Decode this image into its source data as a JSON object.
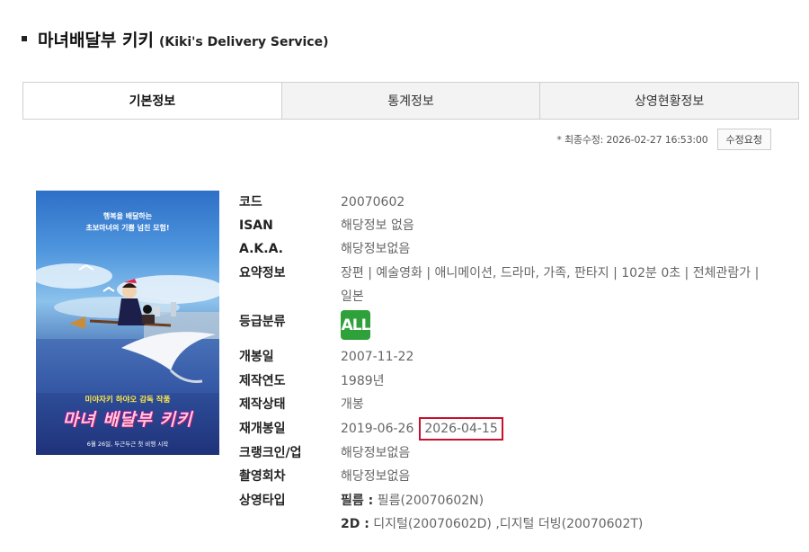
{
  "movie": {
    "title_ko": "마녀배달부 키키",
    "title_en": "(Kiki's Delivery Service)"
  },
  "tabs": [
    {
      "label": "기본정보",
      "active": true
    },
    {
      "label": "통계정보",
      "active": false
    },
    {
      "label": "상영현황정보",
      "active": false
    }
  ],
  "modification": {
    "text": "* 최종수정: 2026-02-27 16:53:00",
    "button_label": "수정요청"
  },
  "poster": {
    "tagline_line1": "행복을 배달하는",
    "tagline_line2": "초보마녀의 기쁨 넘친 모험!",
    "director": "미야자키 하야오 감독 작품",
    "title": "마녀 배달부 키키",
    "release": "6월 26일, 두근두근 첫 비행 시작"
  },
  "details": {
    "code": {
      "label": "코드",
      "value": "20070602"
    },
    "isan": {
      "label": "ISAN",
      "value": "해당정보 없음"
    },
    "aka": {
      "label": "A.K.A.",
      "value": "해당정보없음"
    },
    "summary": {
      "label": "요약정보",
      "value_line1": "장편 | 예술영화 | 애니메이션, 드라마, 가족, 판타지 | 102분 0초 | 전체관람가 |",
      "value_line2": "일본"
    },
    "rating": {
      "label": "등급분류",
      "badge": "ALL",
      "badge_color": "#2fa13a"
    },
    "release_date": {
      "label": "개봉일",
      "value": "2007-11-22"
    },
    "production_year": {
      "label": "제작연도",
      "value": "1989년"
    },
    "production_status": {
      "label": "제작상태",
      "value": "개봉"
    },
    "rerelease": {
      "label": "재개봉일",
      "value": "2019-06-26",
      "highlighted": "2026-04-15"
    },
    "crank": {
      "label": "크랭크인/업",
      "value": "해당정보없음"
    },
    "shooting": {
      "label": "촬영회차",
      "value": "해당정보없음"
    },
    "screening_type": {
      "label": "상영타입",
      "film_label": "필름 :",
      "film_value": "필름(20070602N)",
      "digital_label": "2D :",
      "digital_value": "디지털(20070602D) ,디지털 더빙(20070602T)"
    }
  },
  "colors": {
    "highlight_border": "#c8102e",
    "tab_inactive_bg": "#f3f3f3"
  }
}
